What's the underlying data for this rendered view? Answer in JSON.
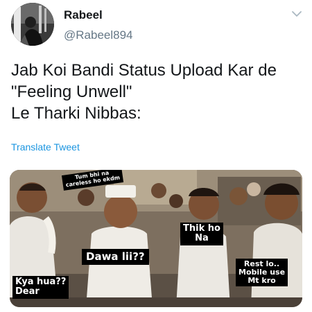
{
  "author": {
    "name": "Rabeel",
    "handle": "@Rabeel894"
  },
  "tweet": {
    "lines": [
      "Jab Koi Bandi Status Upload Kar de",
      "\"Feeling Unwell\"",
      "Le Tharki Nibbas:"
    ],
    "translate_label": "Translate Tweet"
  },
  "meme": {
    "captions": [
      "Tum bhi na\ncareless ho ekdm",
      "Thik ho\nNa",
      "Dawa lii??",
      "Rest lo..\nMobile use\nMt kro",
      "Kya hua??\nDear"
    ]
  },
  "icons": {
    "menu": "chevron-down-icon"
  },
  "colors": {
    "link": "#1b95e0",
    "secondary_text": "#657786",
    "primary_text": "#14171a"
  }
}
